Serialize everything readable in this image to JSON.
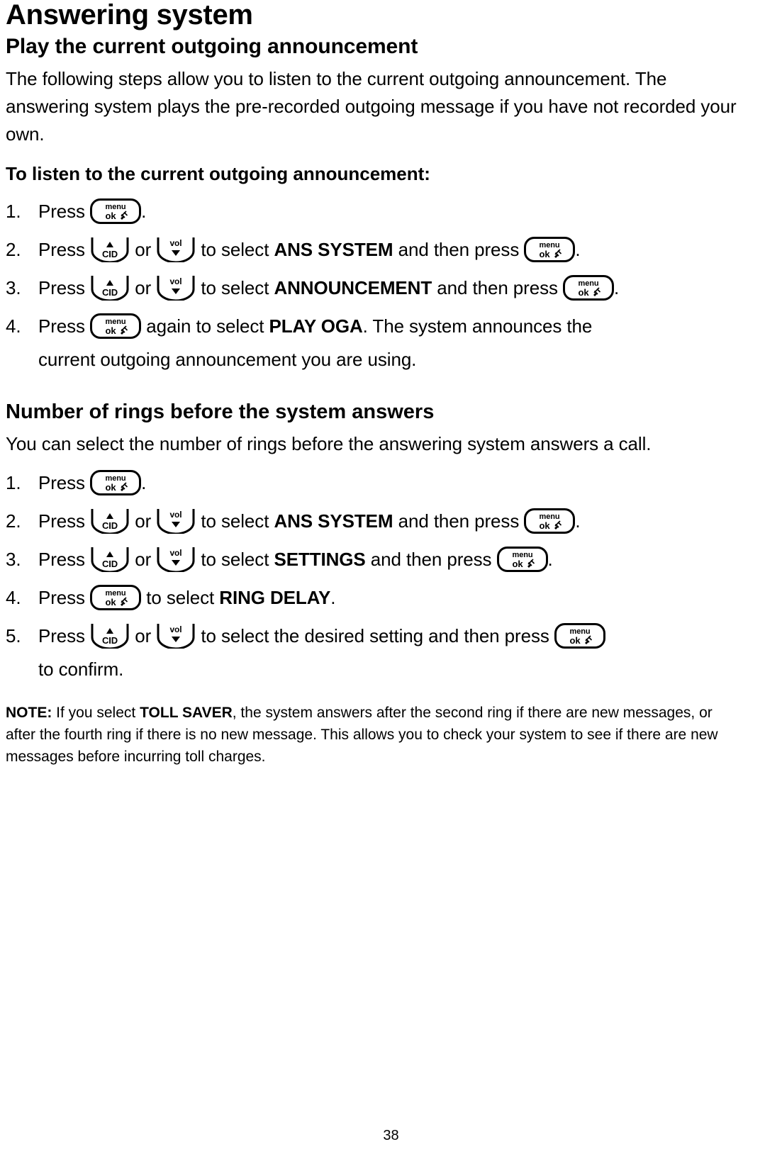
{
  "document": {
    "title": "Answering system",
    "page_number": "38",
    "sections": [
      {
        "heading": "Play the current outgoing announcement",
        "intro": "The following steps allow you to listen to the current outgoing announcement. The answering system plays the pre-recorded outgoing message if you have not recorded your own.",
        "lead": "To listen to the current outgoing announcement:",
        "steps": [
          {
            "num": "1.",
            "text_before": "Press",
            "text_after": "."
          },
          {
            "num": "2.",
            "text_before": "Press",
            "or": "or",
            "text_mid": "to select",
            "menu_item": "ANS SYSTEM",
            "text_after": "and then press",
            "text_end": "."
          },
          {
            "num": "3.",
            "text_before": "Press",
            "or": "or",
            "text_mid": "to select",
            "menu_item": "ANNOUNCEMENT",
            "text_after": "and then press",
            "text_end": "."
          },
          {
            "num": "4.",
            "text_before": "Press",
            "text_mid": "again to select",
            "menu_item": "PLAY OGA",
            "text_after": ". The system announces the",
            "continuation": "current outgoing announcement you are using."
          }
        ]
      },
      {
        "heading": "Number of rings before the system answers",
        "intro": "You can select the number of rings before the answering system answers a call.",
        "steps": [
          {
            "num": "1.",
            "text_before": "Press",
            "text_after": "."
          },
          {
            "num": "2.",
            "text_before": "Press",
            "or": "or",
            "text_mid": "to select",
            "menu_item": "ANS SYSTEM",
            "text_after": "and then press",
            "text_end": "."
          },
          {
            "num": "3.",
            "text_before": "Press",
            "or": "or",
            "text_mid": "to select",
            "menu_item": "SETTINGS",
            "text_after": "and then press",
            "text_end": "."
          },
          {
            "num": "4.",
            "text_before": "Press",
            "text_mid": "to select",
            "menu_item": "RING DELAY",
            "text_after": "."
          },
          {
            "num": "5.",
            "text_before": "Press",
            "or": "or",
            "text_mid": "to select the desired setting and then press",
            "continuation": "to confirm."
          }
        ],
        "note": {
          "label": "NOTE:",
          "text_before": "If you select",
          "bold_term": "TOLL SAVER",
          "text_after": ", the system answers after the second ring if there are new messages, or after the fourth ring if there is no new message. This allows you to check your system to see if there are new messages before incurring toll charges."
        }
      }
    ],
    "keys": {
      "menu_ok": {
        "name": "menu-ok-key",
        "top_label": "menu",
        "bottom_label": "ok"
      },
      "cid_up": {
        "name": "cid-up-key",
        "label": "CID"
      },
      "vol_down": {
        "name": "vol-down-key",
        "label": "vol"
      }
    }
  }
}
